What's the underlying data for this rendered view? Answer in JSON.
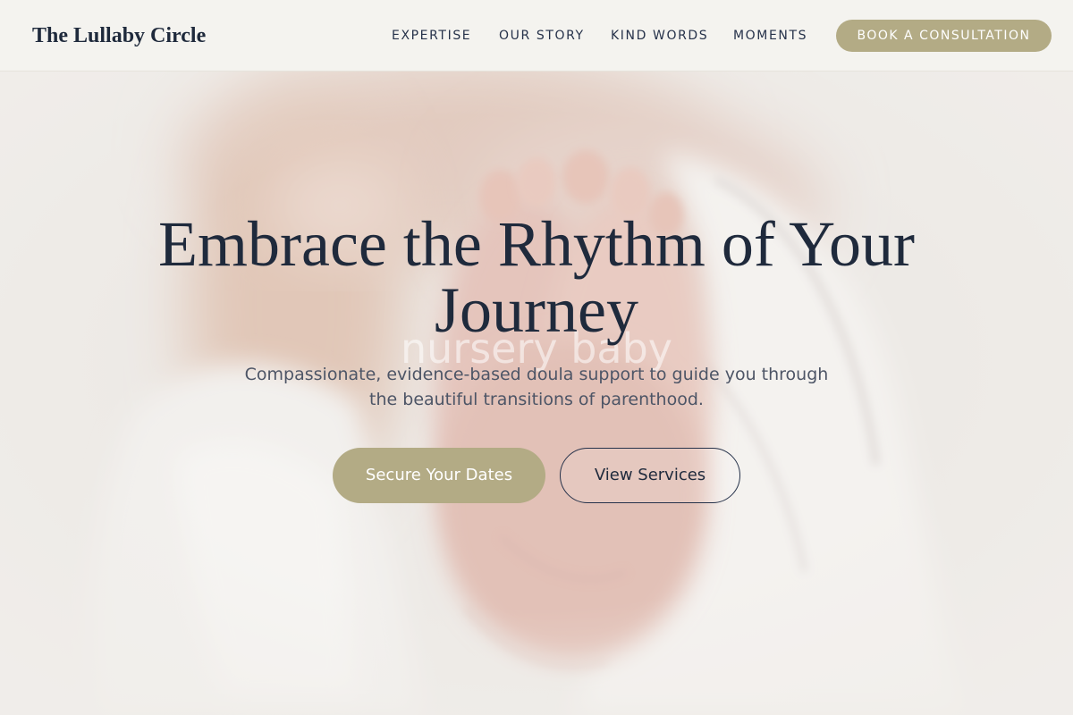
{
  "header": {
    "brand": "The Lullaby Circle",
    "nav": [
      {
        "label": "EXPERTISE"
      },
      {
        "label": "OUR STORY"
      },
      {
        "label": "KIND WORDS"
      },
      {
        "label": "MOMENTS"
      }
    ],
    "cta_label": "BOOK A CONSULTATION"
  },
  "hero": {
    "title": "Embrace the Rhythm of Your Journey",
    "subtitle": "Compassionate, evidence-based doula support to guide you through the beautiful transitions of parenthood.",
    "watermark": "nursery baby",
    "primary_label": "Secure Your Dates",
    "secondary_label": "View Services"
  },
  "colors": {
    "accent": "#b3ab85",
    "ink": "#1f2a3c",
    "header_bg": "#f4f3ef",
    "body_text": "#4d5566"
  }
}
